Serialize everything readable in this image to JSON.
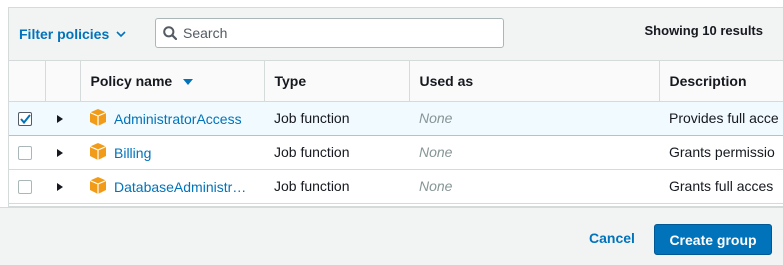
{
  "toolbar": {
    "filter_label": "Filter policies",
    "search_placeholder": "Search",
    "results_text": "Showing 10 results"
  },
  "table": {
    "columns": [
      "Policy name",
      "Type",
      "Used as",
      "Description"
    ],
    "sorted_column": "Policy name",
    "sort_direction": "descending",
    "rows": [
      {
        "selected": true,
        "name": "AdministratorAccess",
        "type": "Job function",
        "used_as": "None",
        "description": "Provides full acce"
      },
      {
        "selected": false,
        "name": "Billing",
        "type": "Job function",
        "used_as": "None",
        "description": "Grants permissio"
      },
      {
        "selected": false,
        "name": "DatabaseAdministrator",
        "type": "Job function",
        "used_as": "None",
        "description": "Grants full acces"
      }
    ]
  },
  "footer": {
    "cancel_label": "Cancel",
    "create_label": "Create group"
  },
  "colors": {
    "link": "#0073bb",
    "primary_button": "#0073bb",
    "selected_row": "#f1faff",
    "package_icon": "#f29b18"
  },
  "icons": {
    "filter": "chevron-down-icon",
    "search": "search-icon",
    "sort": "sort-down-icon",
    "expand": "caret-right-icon",
    "policy": "package-icon",
    "checked": "checkmark-icon"
  }
}
